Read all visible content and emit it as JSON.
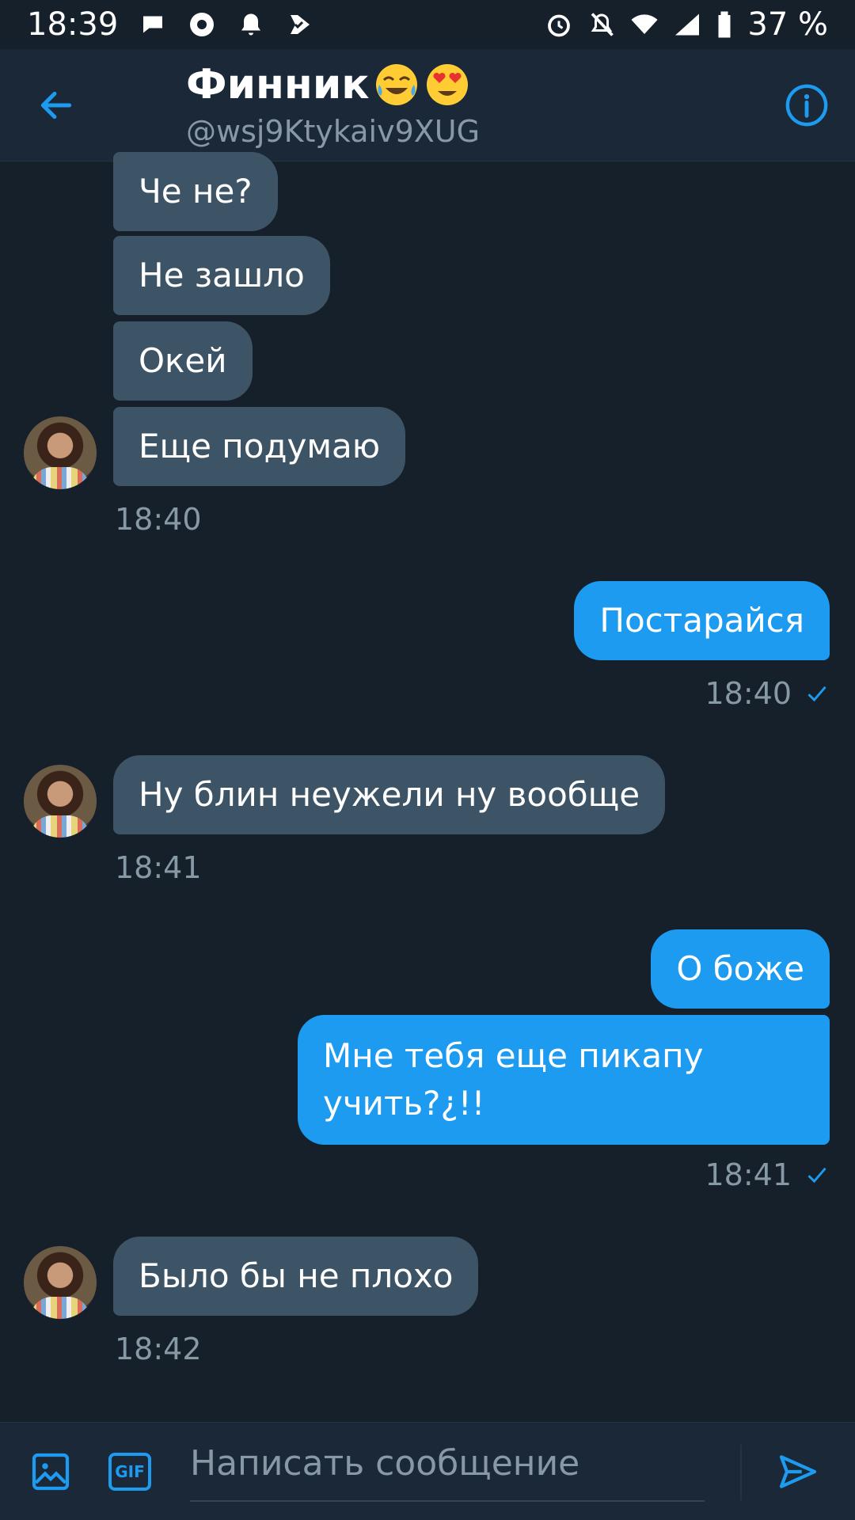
{
  "status_bar": {
    "time": "18:39",
    "battery": "37 %"
  },
  "header": {
    "name": "Финник",
    "handle": "@wsj9Ktykaiv9XUG",
    "emoji_1": "joy-emoji",
    "emoji_2": "heart-eyes-emoji"
  },
  "messages": {
    "m1": "Че не?",
    "m2": "Не зашло",
    "m3": "Окей",
    "m4": "Еще подумаю",
    "t1": "18:40",
    "m5": "Постарайся",
    "t2": "18:40",
    "m6": "Ну блин неужели ну вообще",
    "t3": "18:41",
    "m7": "О боже",
    "m8": "Мне тебя еще пикапу учить?¿!!",
    "t4": "18:41",
    "m9": "Было бы не плохо",
    "t5": "18:42"
  },
  "composer": {
    "placeholder": "Написать сообщение",
    "gif_label": "GIF"
  },
  "colors": {
    "background": "#15202b",
    "header": "#1b2838",
    "incoming_bubble": "#3d5466",
    "outgoing_bubble": "#1d9bf0",
    "accent": "#1d9bf0",
    "muted_text": "#8899a6"
  }
}
